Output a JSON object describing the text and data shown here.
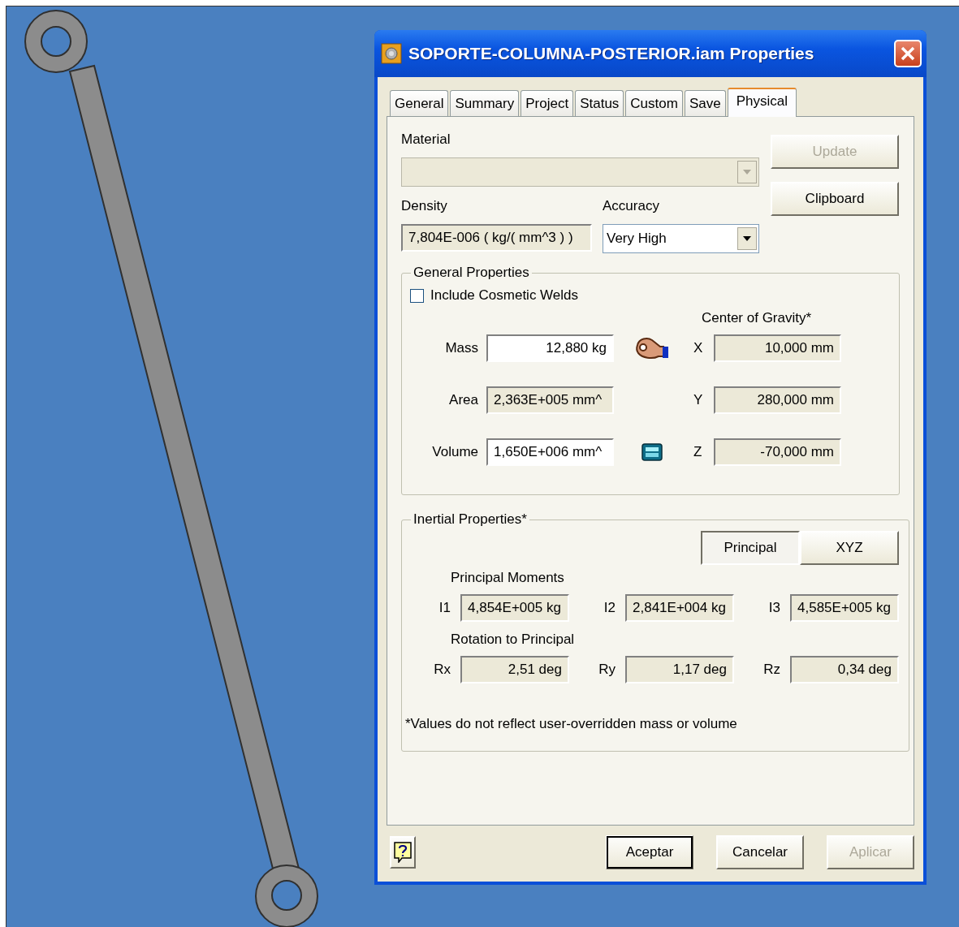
{
  "window": {
    "title": "SOPORTE-COLUMNA-POSTERIOR.iam Properties"
  },
  "tabs": [
    {
      "label": "General",
      "selected": false
    },
    {
      "label": "Summary",
      "selected": false
    },
    {
      "label": "Project",
      "selected": false
    },
    {
      "label": "Status",
      "selected": false
    },
    {
      "label": "Custom",
      "selected": false
    },
    {
      "label": "Save",
      "selected": false
    },
    {
      "label": "Physical",
      "selected": true
    }
  ],
  "material": {
    "label": "Material",
    "disabled": true
  },
  "update_button": {
    "label": "Update",
    "disabled": true
  },
  "density": {
    "label": "Density",
    "value": "7,804E-006 ( kg/( mm^3 ) )"
  },
  "accuracy": {
    "label": "Accuracy",
    "value": "Very High"
  },
  "clipboard_button": {
    "label": "Clipboard",
    "disabled": false
  },
  "general_properties": {
    "title": "General Properties",
    "include_cosmetic_welds": {
      "label": "Include Cosmetic Welds",
      "checked": false
    },
    "center_of_gravity_label": "Center of Gravity*",
    "rows": [
      {
        "label": "Mass",
        "value": "12,880 kg",
        "editable": true,
        "kind": "hand",
        "axis": "X",
        "cog": "10,000 mm"
      },
      {
        "label": "Area",
        "value": "2,363E+005 mm^",
        "editable": false,
        "kind": "none",
        "axis": "Y",
        "cog": "280,000 mm"
      },
      {
        "label": "Volume",
        "value": "1,650E+006 mm^",
        "editable": true,
        "kind": "calculator",
        "axis": "Z",
        "cog": "-70,000 mm"
      }
    ]
  },
  "inertial_properties": {
    "title": "Inertial Properties*",
    "view_buttons": [
      {
        "label": "Principal",
        "selected": true
      },
      {
        "label": "XYZ",
        "selected": false
      }
    ],
    "moments_label": "Principal Moments",
    "moments": [
      {
        "label": "I1",
        "value": "4,854E+005 kg"
      },
      {
        "label": "I2",
        "value": "2,841E+004 kg"
      },
      {
        "label": "I3",
        "value": "4,585E+005 kg"
      }
    ],
    "rotation_label": "Rotation to Principal",
    "rotations": [
      {
        "label": "Rx",
        "value": "2,51 deg"
      },
      {
        "label": "Ry",
        "value": "1,17 deg"
      },
      {
        "label": "Rz",
        "value": "0,34 deg"
      }
    ],
    "footnote": "*Values do not reflect user-overridden mass or volume"
  },
  "buttons": [
    {
      "label": "Aceptar",
      "default": true,
      "disabled": false
    },
    {
      "label": "Cancelar",
      "default": false,
      "disabled": false
    },
    {
      "label": "Aplicar",
      "default": false,
      "disabled": true
    }
  ]
}
